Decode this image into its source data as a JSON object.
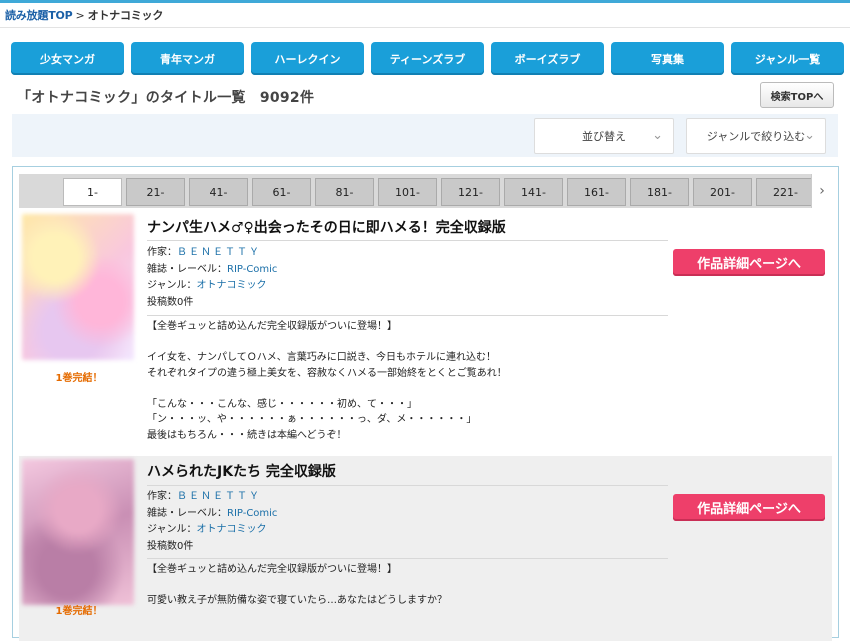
{
  "breadcrumb": {
    "home": "読み放題TOP",
    "separator": ">",
    "current": "オトナコミック"
  },
  "genres": [
    "少女マンガ",
    "青年マンガ",
    "ハーレクイン",
    "ティーンズラブ",
    "ボーイズラブ",
    "写真集",
    "ジャンル一覧"
  ],
  "list_header": {
    "title": "「オトナコミック」のタイトル一覧",
    "count": "9092件",
    "search_top": "検索TOPへ"
  },
  "filters": {
    "sort_label": "並び替え",
    "genre_label": "ジャンルで絞り込む",
    "chevron": "chevron-down-icon"
  },
  "pager": {
    "pages": [
      "1-",
      "21-",
      "41-",
      "61-",
      "81-",
      "101-",
      "121-",
      "141-",
      "161-",
      "181-",
      "201-",
      "221-"
    ],
    "active": "1-",
    "next_icon": "chevron-right-icon"
  },
  "items": [
    {
      "title": "ナンパ生ハメ♂♀出会ったその日に即ハメる！完全収録版",
      "author_label": "作家：",
      "author": "ＢＥＮＥＴＴＹ",
      "magazine_label": "雑誌・レーベル：",
      "magazine": "RIP-Comic",
      "genre_label": "ジャンル：",
      "genre": "オトナコミック",
      "posts": "投稿数0件",
      "volume": "1巻完結！",
      "detail_button": "作品詳細ページへ",
      "description": "【全巻ギュッと詰め込んだ完全収録版がついに登場！】\n\nイイ女を、ナンパしてＯハメ、言葉巧みに口説き、今日もホテルに連れ込む！\nそれぞれタイプの違う極上美女を、容赦なくハメる一部始終をとくとご覧あれ！\n\n「こんな・・・こんな、感じ・・・・・・初め、て・・・」\n「ン・・・ッ、や・・・・・・ぁ・・・・・・っ、ダ、メ・・・・・・」\n最後はもちろん・・・続きは本編へどうぞ！"
    },
    {
      "title": "ハメられたJKたち 完全収録版",
      "author_label": "作家：",
      "author": "ＢＥＮＥＴＴＹ",
      "magazine_label": "雑誌・レーベル：",
      "magazine": "RIP-Comic",
      "genre_label": "ジャンル：",
      "genre": "オトナコミック",
      "posts": "投稿数0件",
      "volume": "1巻完結！",
      "detail_button": "作品詳細ページへ",
      "description": "【全巻ギュッと詰め込んだ完全収録版がついに登場！】\n\n可愛い教え子が無防備な姿で寝ていたら…あなたはどうしますか？"
    }
  ]
}
